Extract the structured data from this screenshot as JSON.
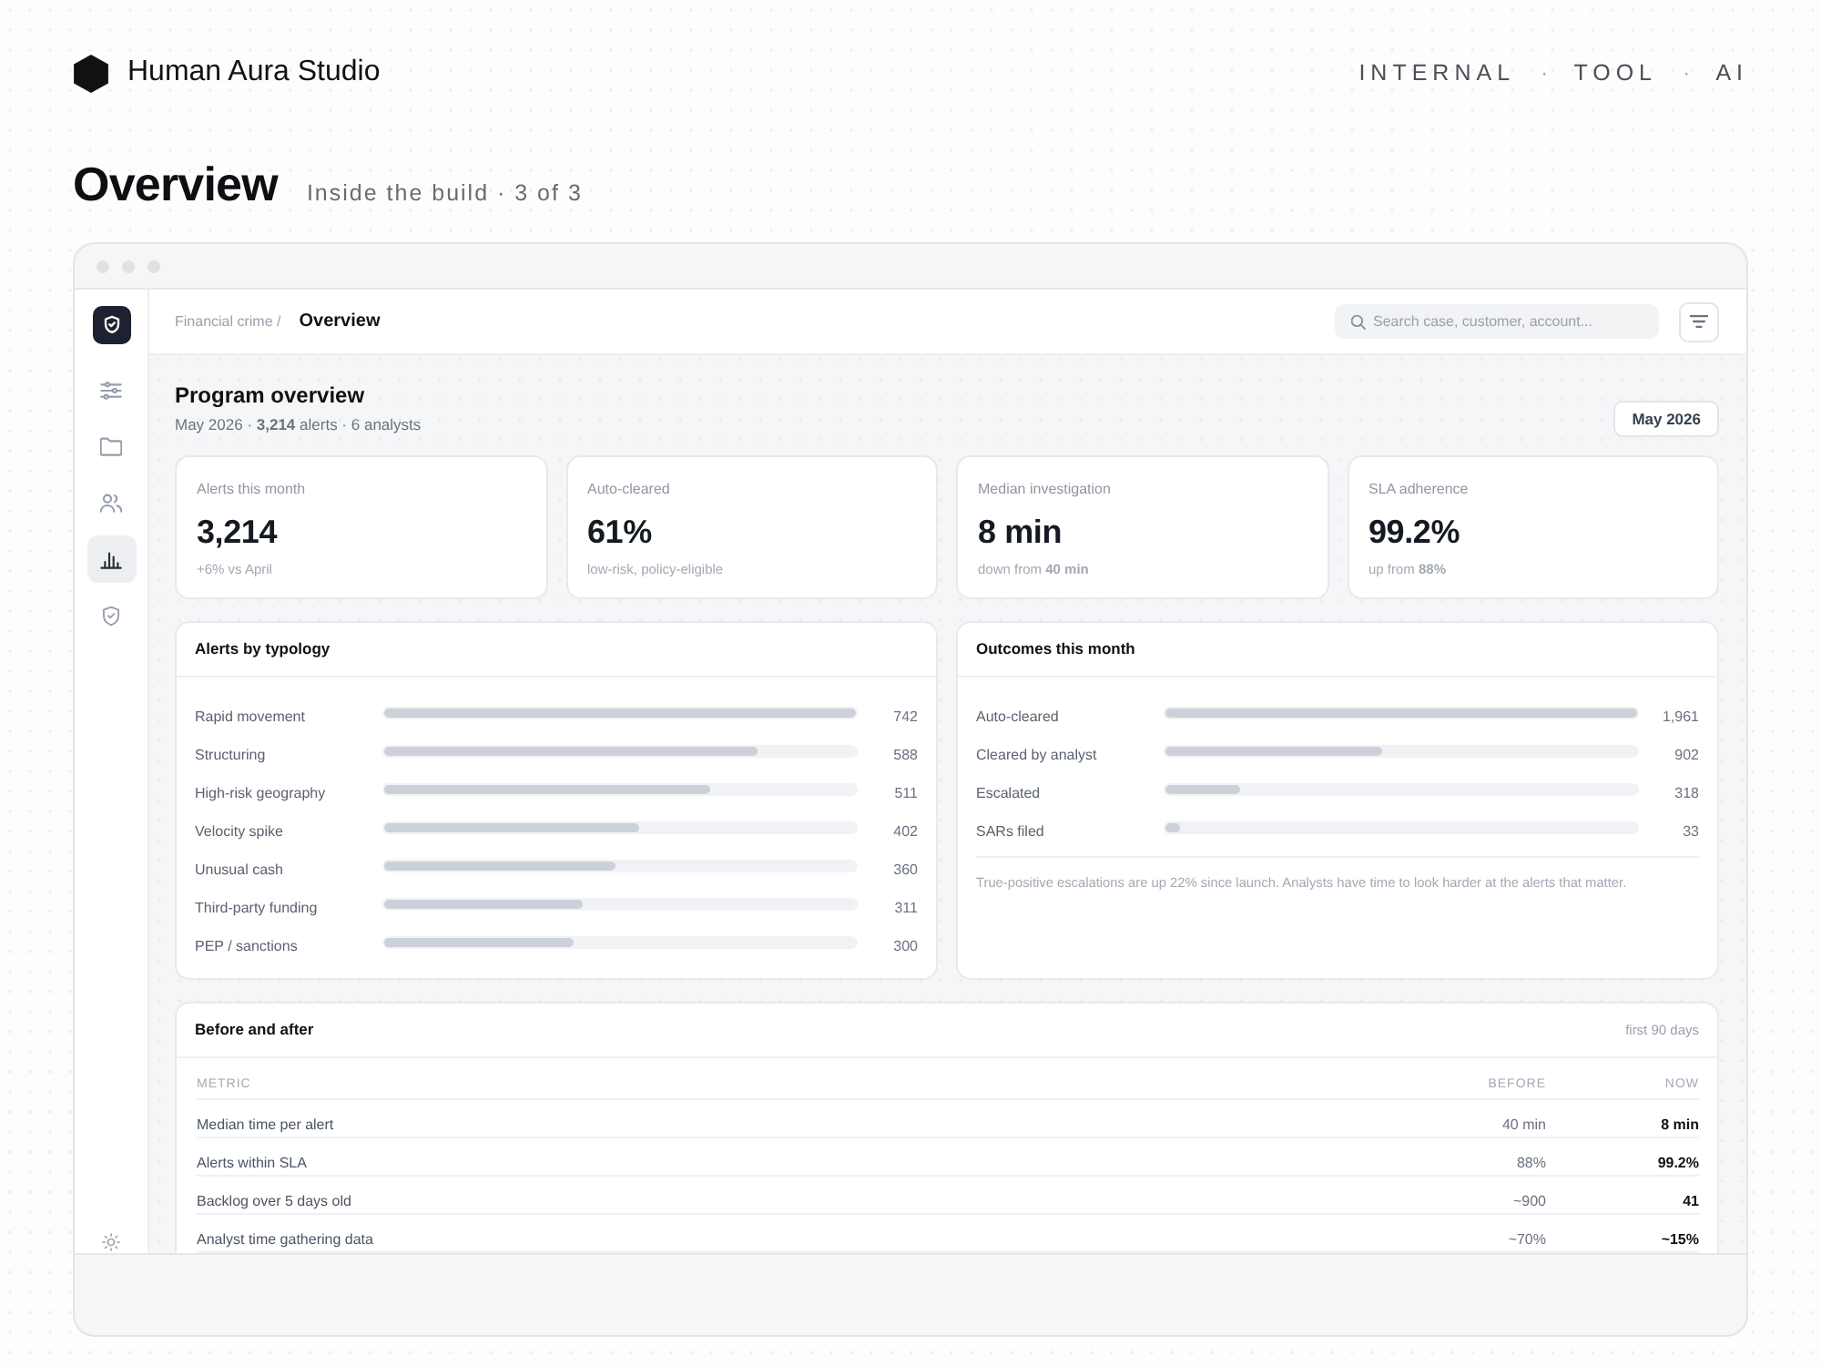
{
  "header": {
    "brand": "Human Aura Studio",
    "tagline": {
      "items": [
        "INTERNAL",
        "TOOL",
        "AI"
      ],
      "separator": "·"
    }
  },
  "page": {
    "title": "Overview",
    "subtitle": "Inside the build · 3 of 3"
  },
  "app": {
    "sidebar": {
      "items": [
        {
          "kind": "filters",
          "selected": false
        },
        {
          "kind": "folder",
          "selected": false
        },
        {
          "kind": "people",
          "selected": false
        },
        {
          "kind": "chart",
          "selected": true
        },
        {
          "kind": "shield",
          "selected": false
        }
      ]
    },
    "top_bar": {
      "breadcrumb": "Financial crime /",
      "current": "Overview",
      "search": {
        "placeholder": "Search case, customer, account..."
      }
    },
    "summary": {
      "title": "Program overview",
      "subtitle": "May 2026 · **3,214** alerts · 6 analysts",
      "period_button": "May 2026"
    },
    "stats": [
      {
        "label": "Alerts this month",
        "value": "3,214",
        "note": "+6% vs April"
      },
      {
        "label": "Auto-cleared",
        "value": "61%",
        "note": "low-risk, policy-eligible"
      },
      {
        "label": "Median investigation",
        "value": "8 min",
        "note": "down from **40 min**"
      },
      {
        "label": "SLA adherence",
        "value": "99.2%",
        "note": "up from **88%**"
      }
    ],
    "typology": {
      "title": "Alerts by typology",
      "rows": [
        {
          "label": "Rapid movement",
          "value": "742",
          "level": 1
        },
        {
          "label": "Structuring",
          "value": "588",
          "level": 0.79
        },
        {
          "label": "High-risk geography",
          "value": "511",
          "level": 0.69
        },
        {
          "label": "Velocity spike",
          "value": "402",
          "level": 0.54
        },
        {
          "label": "Unusual cash",
          "value": "360",
          "level": 0.49
        },
        {
          "label": "Third-party funding",
          "value": "311",
          "level": 0.42
        },
        {
          "label": "PEP / sanctions",
          "value": "300",
          "level": 0.4
        }
      ]
    },
    "outcomes": {
      "title": "Outcomes this month",
      "rows": [
        {
          "label": "Auto-cleared",
          "value": "1,961",
          "level": 1
        },
        {
          "label": "Cleared by analyst",
          "value": "902",
          "level": 0.46
        },
        {
          "label": "Escalated",
          "value": "318",
          "level": 0.16
        },
        {
          "label": "SARs filed",
          "value": "33",
          "level": 0.03
        }
      ],
      "note": "True-positive escalations are up 22% since launch. Analysts have time to look harder at the alerts that matter."
    },
    "comparison": {
      "title": "Before and after",
      "period": "first 90 days",
      "columns": [
        "METRIC",
        "BEFORE",
        "NOW"
      ],
      "rows": [
        [
          "Median time per alert",
          "40 min",
          "8 min"
        ],
        [
          "Alerts within SLA",
          "88%",
          "99.2%"
        ],
        [
          "Backlog over 5 days old",
          "~900",
          "41"
        ],
        [
          "Analyst time gathering data",
          "~70%",
          "~15%"
        ]
      ]
    }
  }
}
